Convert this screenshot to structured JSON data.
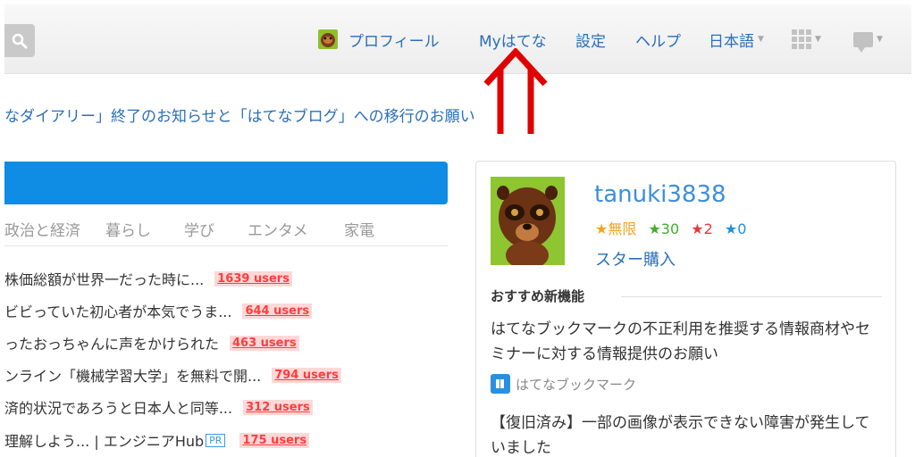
{
  "header": {
    "nav": {
      "profile": "プロフィール",
      "my_hatena": "Myはてな",
      "settings": "設定",
      "help": "ヘルプ",
      "language": "日本語"
    }
  },
  "notice": "なダイアリー」終了のお知らせと「はてなブログ」への移行のお願い",
  "categories": [
    "政治と経済",
    "暮らし",
    "学び",
    "エンタメ",
    "家電"
  ],
  "entries": [
    {
      "title": "株価総額が世界一だった時に...",
      "users": "1639 users"
    },
    {
      "title": "ビビっていた初心者が本気でうま...",
      "users": "644 users"
    },
    {
      "title": "ったおっちゃんに声をかけられた",
      "users": "463 users"
    },
    {
      "title": "ンライン「機械学習大学」を無料で開...",
      "users": "794 users"
    },
    {
      "title": "済的状況であろうと日本人と同等...",
      "users": "312 users"
    },
    {
      "title": "理解しよう... | エンジニアHub",
      "pr": "PR",
      "users": "175 users"
    }
  ],
  "profile_card": {
    "username": "tanuki3838",
    "stars": {
      "yellow": "★無限",
      "green": "★30",
      "red": "★2",
      "blue": "★0"
    },
    "star_buy": "スター購入",
    "section_title": "おすすめ新機能",
    "feature_1": "はてなブックマークの不正利用を推奨する情報商材やセミナーに対する情報提供のお願い",
    "feature_1_source": "はてなブックマーク",
    "feature_2": "【復旧済み】一部の画像が表示できない障害が発生していました"
  },
  "colors": {
    "link": "#2a6fb8",
    "blue_bar": "#0f8ce3",
    "users_red": "#ff3d3d",
    "star_yellow": "#f3a51e",
    "star_green": "#3fae29",
    "star_red": "#e8383d",
    "star_blue": "#1e90e0",
    "annotation_arrow": "#e00000"
  },
  "icons": [
    "search-icon",
    "tanuki-avatar-icon",
    "apps-grid-icon",
    "notification-bubble-icon",
    "hatena-bookmark-icon",
    "red-double-arrow-annotation"
  ]
}
